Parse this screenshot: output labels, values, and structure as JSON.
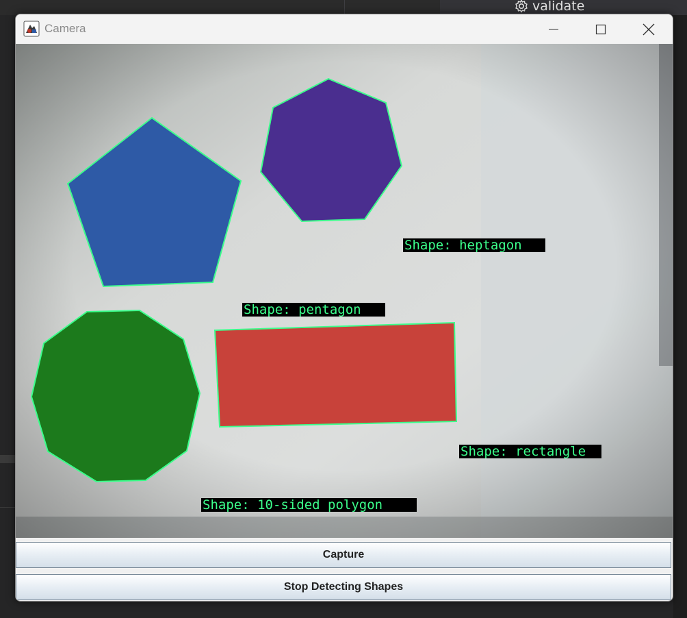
{
  "background": {
    "toolbar_item": {
      "label": "validate",
      "icon": "gear-icon"
    }
  },
  "window": {
    "title": "Camera",
    "icon": "java-app-icon",
    "controls": {
      "minimize": "minimize-icon",
      "maximize": "maximize-icon",
      "close": "close-icon"
    }
  },
  "camera_feed": {
    "labels": {
      "heptagon": "Shape: heptagon",
      "pentagon": "Shape: pentagon",
      "rectangle": "Shape: rectangle",
      "decagon": "Shape: 10-sided polygon"
    },
    "colors": {
      "pentagon": "#2e5aa6",
      "heptagon": "#4a2e8f",
      "decagon": "#1c7a1c",
      "rectangle": "#c8423a",
      "outline": "#3cff8c",
      "label_text": "#3cff8c",
      "label_bg": "#000000"
    }
  },
  "buttons": {
    "capture": "Capture",
    "stop_detecting": "Stop Detecting Shapes"
  }
}
